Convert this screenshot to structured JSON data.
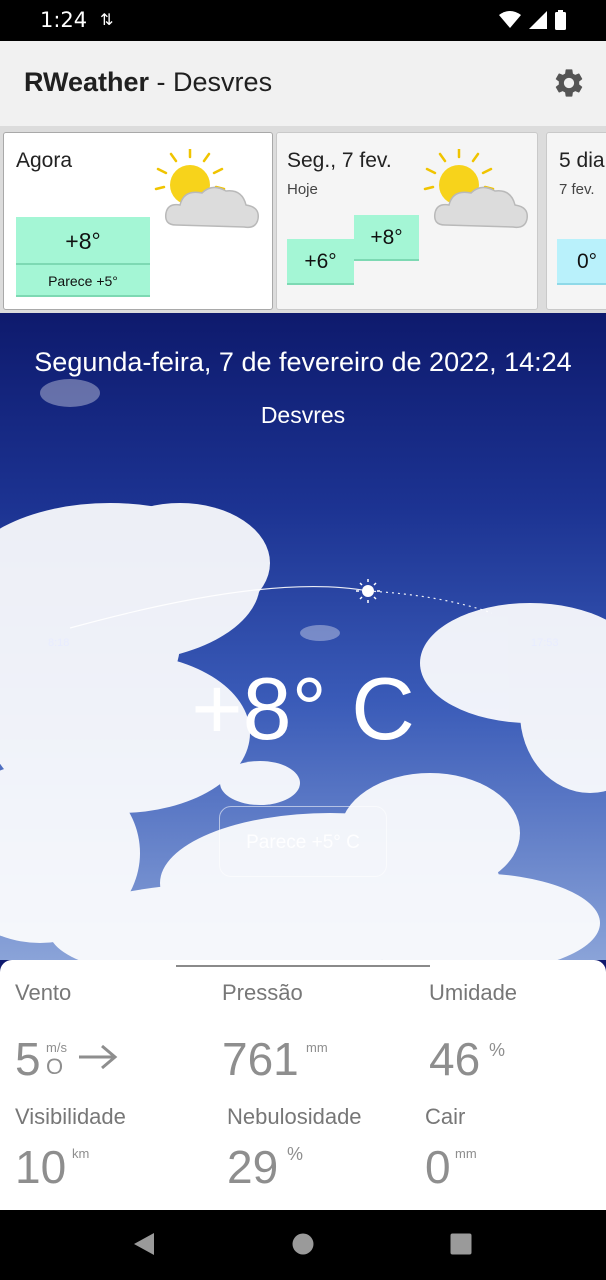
{
  "status_bar": {
    "time": "1:24",
    "data_icon": "data-transfer-icon",
    "wifi_icon": "wifi-icon",
    "signal_icon": "signal-icon",
    "battery_icon": "battery-icon"
  },
  "app_bar": {
    "brand": "RWeather",
    "separator": " - ",
    "city": "Desvres",
    "settings_icon": "gear-icon"
  },
  "forecast": {
    "cards": [
      {
        "title": "Agora",
        "temp": "+8°",
        "feels": "Parece +5°",
        "icon": "partly-cloudy-icon"
      },
      {
        "title": "Seg., 7 fev.",
        "subtitle": "Hoje",
        "high": "+8°",
        "low": "+6°",
        "icon": "partly-cloudy-icon"
      },
      {
        "title": "5 dia",
        "subtitle": "7 fev.",
        "low": "0°"
      }
    ]
  },
  "hero": {
    "date": "Segunda-feira, 7 de fevereiro de 2022, 14:24",
    "city": "Desvres",
    "sunrise": "8:18",
    "sunset": "17:53",
    "temp": "+8° C",
    "feels": "Parece  +5° C",
    "sun_progress": 0.58
  },
  "details": {
    "wind": {
      "label": "Vento",
      "value": "5",
      "unit": "m/s",
      "direction": "O",
      "arrow_icon": "arrow-right-icon"
    },
    "pressure": {
      "label": "Pressão",
      "value": "761",
      "unit": "mm"
    },
    "humidity": {
      "label": "Umidade",
      "value": "46",
      "unit": "%"
    },
    "visibility": {
      "label": "Visibilidade",
      "value": "10",
      "unit": "km"
    },
    "cloudiness": {
      "label": "Nebulosidade",
      "value": "29",
      "unit": "%"
    },
    "precipitation": {
      "label": "Cair",
      "value": "0",
      "unit": "mm"
    }
  },
  "nav_bar": {
    "back_icon": "back-icon",
    "home_icon": "home-icon",
    "recents_icon": "recents-icon"
  },
  "colors": {
    "temp_box": "#a4f6d5",
    "app_bar": "#f1f1f1",
    "sky_top": "#0e1a6d"
  }
}
